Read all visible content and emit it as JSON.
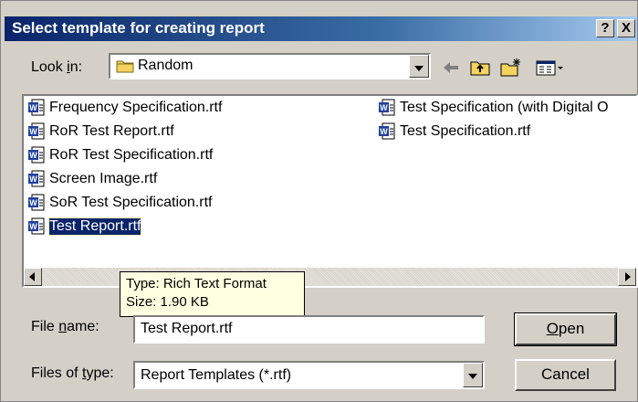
{
  "window": {
    "title": "Select template for creating report",
    "help_btn": "?",
    "close_btn": "X"
  },
  "look_in": {
    "label_prefix": "Look ",
    "label_underlined": "i",
    "label_suffix": "n:",
    "value": "Random",
    "folder_icon": "folder-icon"
  },
  "toolbar": {
    "back_icon": "back-arrow-icon",
    "up_icon": "up-folder-icon",
    "new_folder_icon": "new-folder-icon",
    "view_menu_icon": "view-menu-icon"
  },
  "files": {
    "column1": [
      {
        "name": "Frequency Specification.rtf",
        "selected": false
      },
      {
        "name": "RoR Test Report.rtf",
        "selected": false
      },
      {
        "name": "RoR Test Specification.rtf",
        "selected": false
      },
      {
        "name": "Screen Image.rtf",
        "selected": false
      },
      {
        "name": "SoR Test Specification.rtf",
        "selected": false
      },
      {
        "name": "Test Report.rtf",
        "selected": true
      }
    ],
    "column2": [
      {
        "name": "Test Specification (with Digital O",
        "selected": false
      },
      {
        "name": "Test Specification.rtf",
        "selected": false
      }
    ],
    "icon": "word-document-icon"
  },
  "tooltip": {
    "line1": "Type: Rich Text Format",
    "line2": "Size: 1.90 KB"
  },
  "file_name": {
    "label_prefix": "File ",
    "label_underlined": "n",
    "label_suffix": "ame:",
    "value": "Test Report.rtf"
  },
  "file_type": {
    "label_prefix": "Files of ",
    "label_underlined": "t",
    "label_suffix": "ype:",
    "value": "Report Templates (*.rtf)"
  },
  "buttons": {
    "open_underlined": "O",
    "open_rest": "pen",
    "cancel": "Cancel"
  },
  "colors": {
    "title_start": "#0a246a",
    "title_end": "#a6caf0",
    "face": "#d4d0c8",
    "selection": "#0a246a",
    "tooltip_bg": "#ffffe1"
  }
}
